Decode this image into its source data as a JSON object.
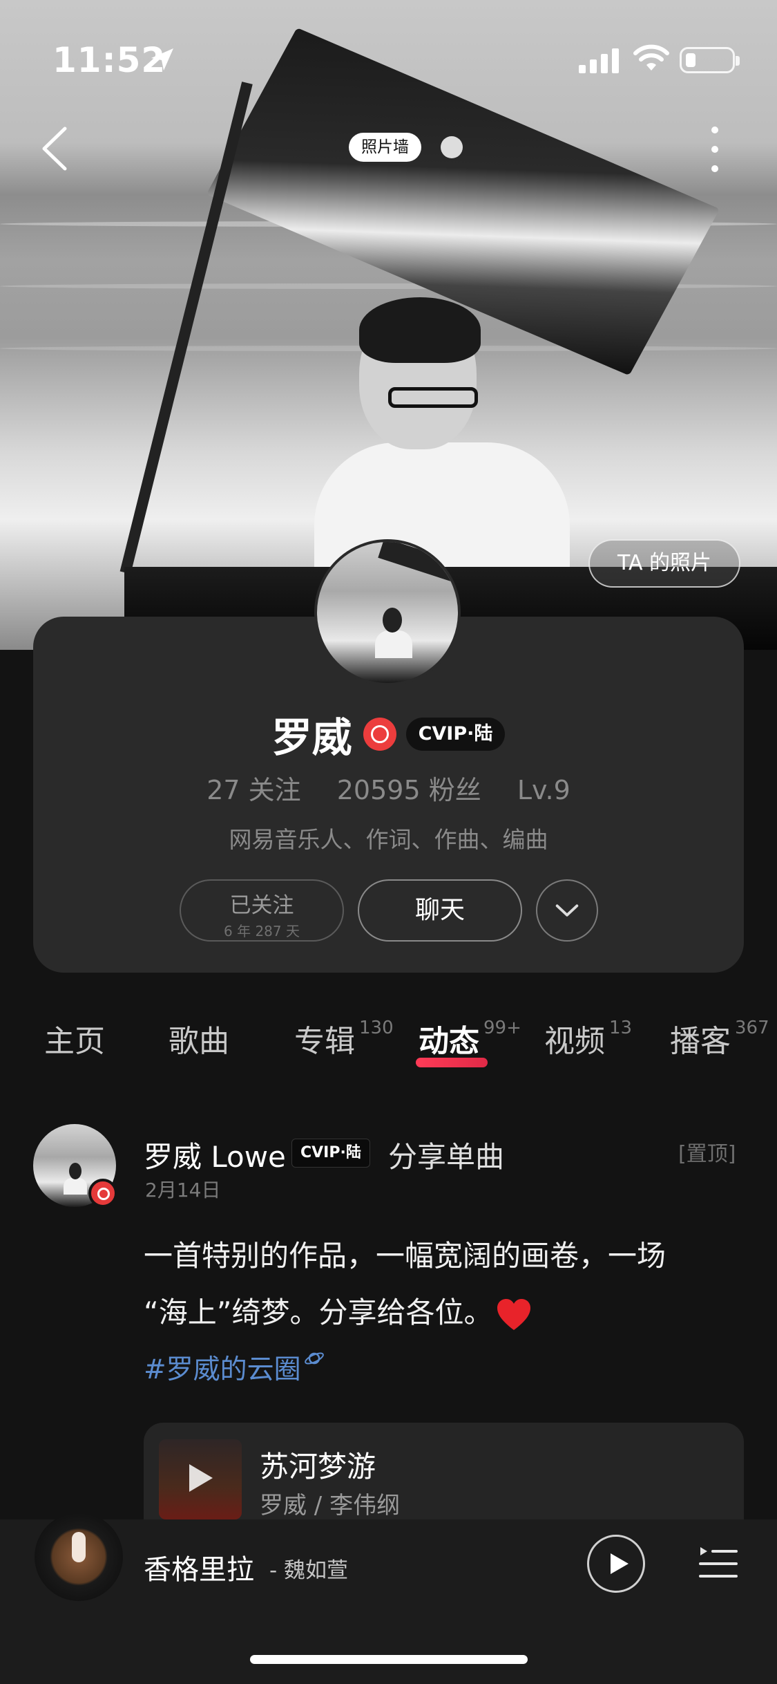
{
  "status_bar": {
    "time": "11:52"
  },
  "header": {
    "photo_wall_label": "照片墙",
    "ta_photos_label": "TA 的照片"
  },
  "profile": {
    "name": "罗威",
    "vip_badge": "ⅭVIP·陆",
    "following_count": "27",
    "following_label": "关注",
    "followers_count": "20595",
    "followers_label": "粉丝",
    "level": "Lv.9",
    "bio": "网易音乐人、作词、作曲、编曲",
    "followed_label": "已关注",
    "followed_duration": "6 年 287 天",
    "chat_label": "聊天"
  },
  "tabs": [
    {
      "label": "主页",
      "count": ""
    },
    {
      "label": "歌曲",
      "count": ""
    },
    {
      "label": "专辑",
      "count": "130"
    },
    {
      "label": "动态",
      "count": "99+",
      "active": true
    },
    {
      "label": "视频",
      "count": "13"
    },
    {
      "label": "播客",
      "count": "367"
    }
  ],
  "post": {
    "author": "罗威 Lowe",
    "vip_badge": "ⅭVIP·陆",
    "action": "分享单曲",
    "pinned": "[置顶]",
    "date": "2月14日",
    "text_line1": "一首特别的作品，一幅宽阔的画卷，一场",
    "text_line2": "“海上”绮梦。分享给各位。",
    "hashtag": "#罗威的云圈",
    "song": {
      "title": "苏河梦游",
      "artist": "罗威 / 李伟纲"
    }
  },
  "player": {
    "track": "香格里拉",
    "artist": "- 魏如萱"
  },
  "colors": {
    "accent": "#ec3d3d",
    "hashtag": "#5b8cd0",
    "background": "#131313",
    "card": "#2a2a2a"
  }
}
